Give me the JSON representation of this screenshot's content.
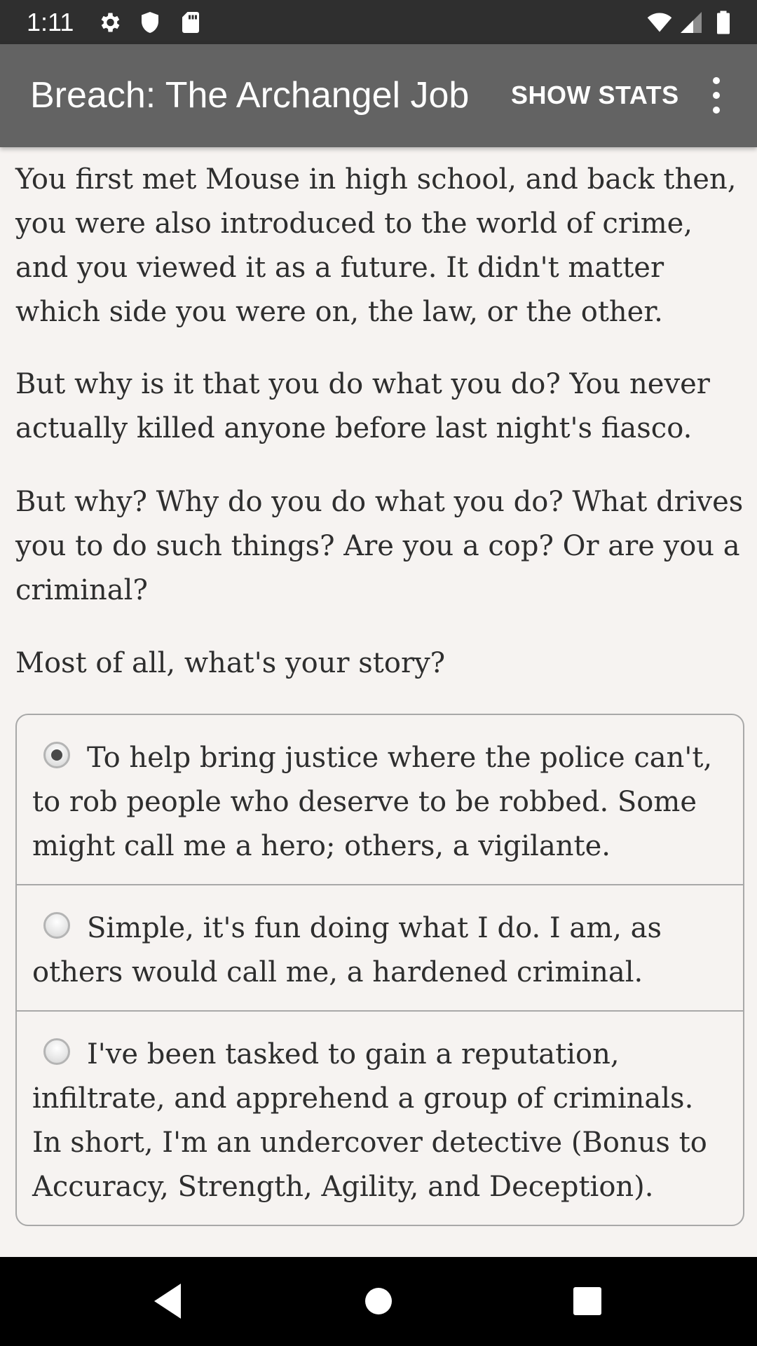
{
  "status_bar": {
    "time": "1:11",
    "left_icons": [
      "gear-icon",
      "shield-icon",
      "sd-card-icon"
    ],
    "right_icons": [
      "wifi-icon",
      "signal-icon",
      "battery-icon"
    ]
  },
  "app_bar": {
    "title": "Breach: The Archangel Job",
    "show_stats_label": "SHOW STATS",
    "menu_icon": "overflow-menu-icon"
  },
  "story": {
    "paragraphs": [
      "You first met Mouse in high school, and back then, you were also introduced to the world of crime, and you viewed it as a future. It didn't matter which side you were on, the law, or the other.",
      "But why is it that you do what you do? You never actually killed anyone before last night's fiasco.",
      "But why? Why do you do what you do? What drives you to do such things? Are you a cop? Or are you a criminal?",
      "Most of all, what's your story?"
    ]
  },
  "choices": [
    {
      "label": "To help bring justice where the police can't, to rob people who deserve to be robbed. Some might call me a hero; others, a vigilante.",
      "selected": true
    },
    {
      "label": "Simple, it's fun doing what I do. I am, as others would call me, a hardened criminal.",
      "selected": false
    },
    {
      "label": "I've been tasked to gain a reputation, infiltrate, and apprehend a group of criminals. In short, I'm an undercover detective (Bonus to Accuracy, Strength, Agility, and Deception).",
      "selected": false
    }
  ],
  "nav_bar": {
    "buttons": [
      "back-icon",
      "home-icon",
      "recents-icon"
    ]
  }
}
